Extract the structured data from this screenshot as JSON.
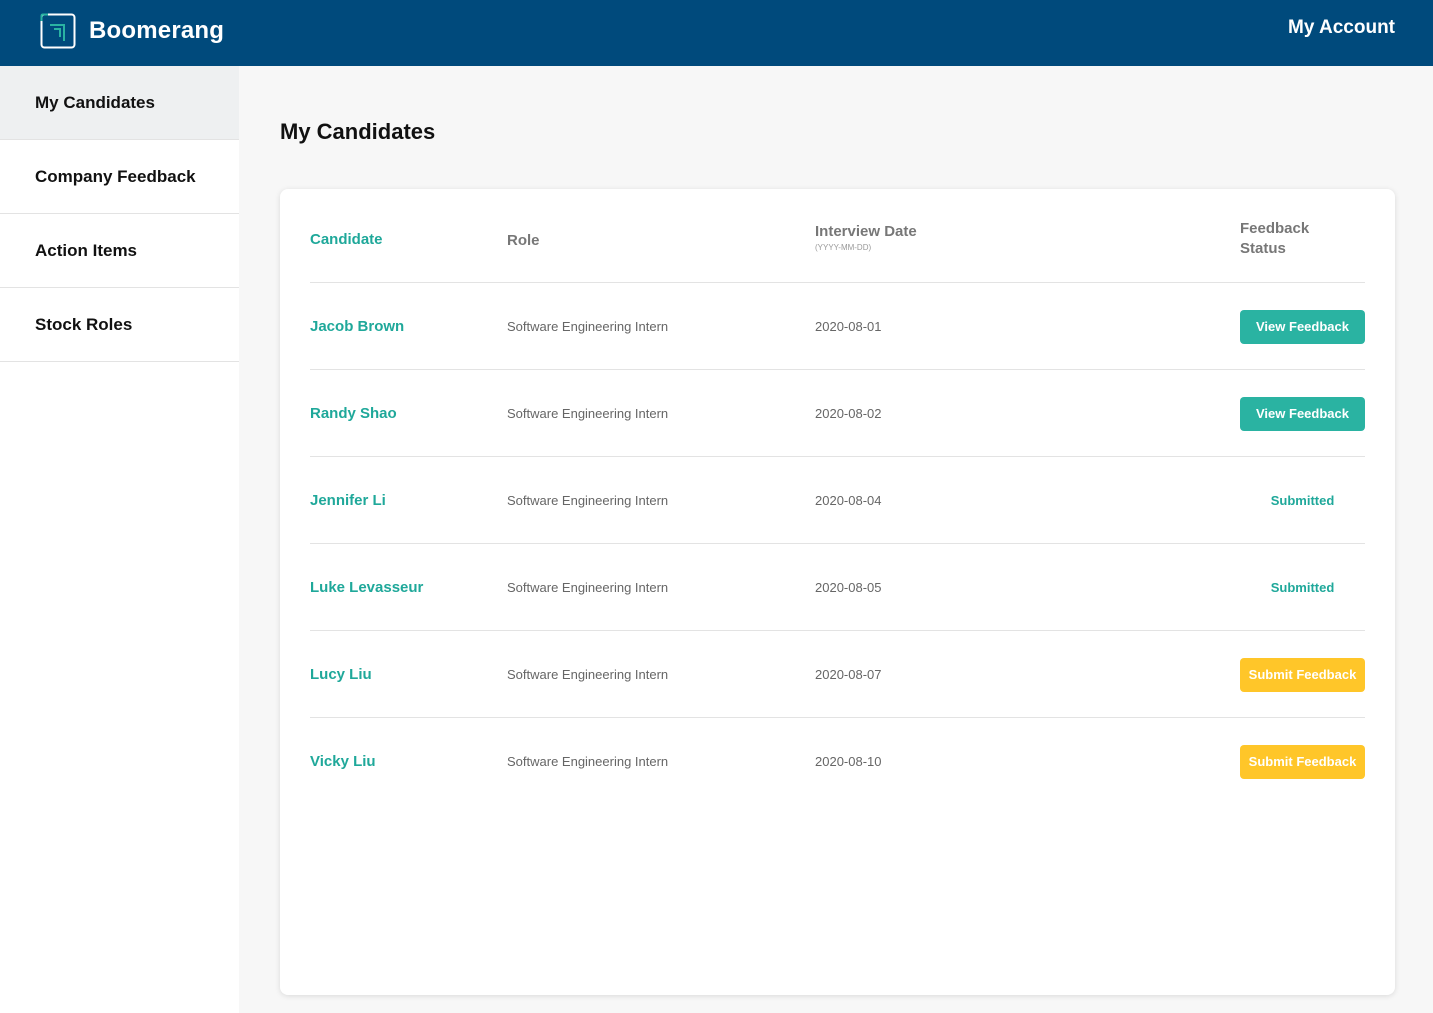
{
  "header": {
    "brand": "Boomerang",
    "account_label": "My Account",
    "bar_color": "#004a7c",
    "logo_icon": "boomerang-logo-icon"
  },
  "sidebar": {
    "items": [
      {
        "label": "My Candidates",
        "active": true
      },
      {
        "label": "Company Feedback",
        "active": false
      },
      {
        "label": "Action Items",
        "active": false
      },
      {
        "label": "Stock Roles",
        "active": false
      }
    ]
  },
  "main": {
    "title": "My Candidates",
    "table": {
      "headers": {
        "candidate": "Candidate",
        "role": "Role",
        "date": "Interview Date",
        "date_format": "(YYYY-MM-DD)",
        "status_line1": "Feedback",
        "status_line2": "Status"
      },
      "rows": [
        {
          "name": "Jacob Brown",
          "role": "Software Engineering Intern",
          "date": "2020-08-01",
          "status": "View Feedback",
          "status_type": "view"
        },
        {
          "name": "Randy Shao",
          "role": "Software Engineering Intern",
          "date": "2020-08-02",
          "status": "View Feedback",
          "status_type": "view"
        },
        {
          "name": "Jennifer Li",
          "role": "Software Engineering Intern",
          "date": "2020-08-04",
          "status": "Submitted",
          "status_type": "submitted"
        },
        {
          "name": "Luke Levasseur",
          "role": "Software Engineering Intern",
          "date": "2020-08-05",
          "status": "Submitted",
          "status_type": "submitted"
        },
        {
          "name": "Lucy Liu",
          "role": "Software Engineering Intern",
          "date": "2020-08-07",
          "status": "Submit Feedback",
          "status_type": "submit"
        },
        {
          "name": "Vicky Liu",
          "role": "Software Engineering Intern",
          "date": "2020-08-10",
          "status": "Submit Feedback",
          "status_type": "submit"
        }
      ]
    }
  },
  "colors": {
    "accent": "#1fa89a",
    "view_button": "#2ab3a2",
    "submit_button": "#ffc629"
  }
}
